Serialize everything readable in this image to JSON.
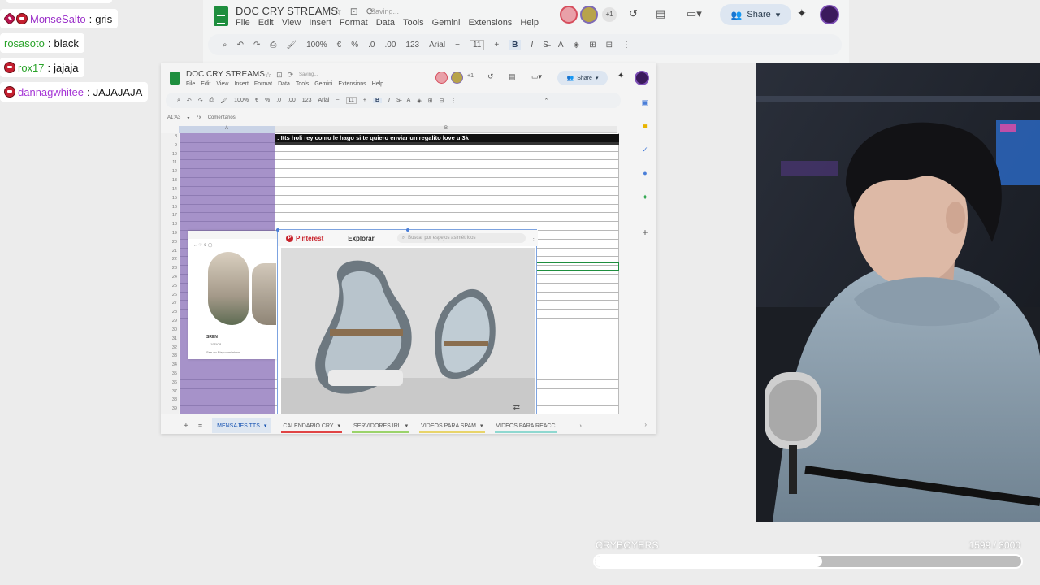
{
  "bg_sheet": {
    "title": "DOC CRY STREAMS",
    "saving": "Saving...",
    "menu": [
      "File",
      "Edit",
      "View",
      "Insert",
      "Format",
      "Data",
      "Tools",
      "Gemini",
      "Extensions",
      "Help"
    ],
    "collaborators_extra": "+1",
    "share_label": "Share",
    "zoom": "100%",
    "currency": "€",
    "percent": "%",
    "decimals_less": ".0",
    "decimals_more": ".00",
    "number_format": "123",
    "font": "Arial",
    "font_size": "11",
    "bold_label": "B",
    "italic_label": "I"
  },
  "chat": [
    {
      "user": "MonseSalto",
      "message": "gris",
      "color": "#9b30c9"
    },
    {
      "user": "rosasoto",
      "message": "black",
      "color": "#2aa32a"
    },
    {
      "user": "rox17",
      "message": "jajaja",
      "color": "#2aa32a"
    },
    {
      "user": "dannagwhitee",
      "message": "JAJAJAJA",
      "color": "#a637d6"
    }
  ],
  "chat_separator": ":",
  "sheet": {
    "title": "DOC CRY STREAMS",
    "saving": "Saving...",
    "menu": [
      "File",
      "Edit",
      "View",
      "Insert",
      "Format",
      "Data",
      "Tools",
      "Gemini",
      "Extensions",
      "Help"
    ],
    "collaborators_extra": "+1",
    "share_label": "Share",
    "zoom": "100%",
    "currency": "€",
    "percent": "%",
    "decimals_less": ".0",
    "decimals_more": ".00",
    "number_format": "123",
    "font": "Arial",
    "font_size": "11",
    "bold_label": "B",
    "italic_label": "I",
    "name_box": "A1:A3",
    "comment_label": "Comentarios",
    "col_a": "A",
    "col_b": "B",
    "tts_message": ": Itts holi rey como le hago si te quiero enviar un regalito love u 3k",
    "row_numbers": [
      "8",
      "9",
      "10",
      "11",
      "12",
      "13",
      "14",
      "15",
      "16",
      "17",
      "18",
      "19",
      "20",
      "21",
      "22",
      "23",
      "24",
      "25",
      "26",
      "27",
      "28",
      "29",
      "30",
      "31",
      "32",
      "33",
      "34",
      "35",
      "36",
      "37",
      "38",
      "39"
    ],
    "mini_card": {
      "title": "SREN",
      "sub": "— 19FIC8",
      "link": "See on Etsy.com/mirror"
    },
    "pinterest": {
      "brand": "Pinterest",
      "explore": "Explorar",
      "search_placeholder": "Buscar por espejos asimétricos"
    },
    "tabs": [
      {
        "label": "MENSAJES TTS",
        "color": "#1a56b3",
        "active": true
      },
      {
        "label": "CALENDARIO CRY",
        "color": "#e04444",
        "active": false
      },
      {
        "label": "SERVIDORES IRL",
        "color": "#9bd36a",
        "active": false
      },
      {
        "label": "VIDEOS PARA SPAM",
        "color": "#e8d46a",
        "active": false
      },
      {
        "label": "VIDEOS PARA REACC",
        "color": "#8fd8d0",
        "active": false
      }
    ]
  },
  "progress": {
    "label": "CRYBOYERS",
    "current": "1599",
    "separator": "/",
    "total": "3000",
    "fraction": 0.533
  }
}
